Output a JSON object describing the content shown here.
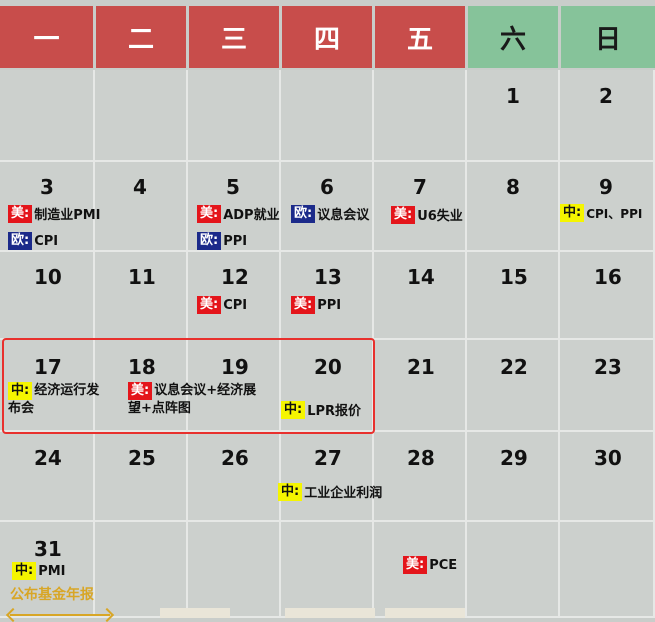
{
  "weekdays": [
    "一",
    "二",
    "三",
    "四",
    "五",
    "六",
    "日"
  ],
  "days": {
    "r0": [
      "",
      "",
      "",
      "",
      "",
      "1",
      "2"
    ],
    "r1": [
      "3",
      "4",
      "5",
      "6",
      "7",
      "8",
      "9"
    ],
    "r2": [
      "10",
      "11",
      "12",
      "13",
      "14",
      "15",
      "16"
    ],
    "r3": [
      "17",
      "18",
      "19",
      "20",
      "21",
      "22",
      "23"
    ],
    "r4": [
      "24",
      "25",
      "26",
      "27",
      "28",
      "29",
      "30"
    ],
    "r5": [
      "31",
      "",
      "",
      "",
      "",
      "",
      ""
    ]
  },
  "events": {
    "d3_us": {
      "tag": "美:",
      "text": "制造业PMI"
    },
    "d3_eu": {
      "tag": "欧:",
      "text": "CPI"
    },
    "d5_us": {
      "tag": "美:",
      "text": "ADP就业"
    },
    "d5_eu": {
      "tag": "欧:",
      "text": "PPI"
    },
    "d6_eu": {
      "tag": "欧:",
      "text": "议息会议"
    },
    "d7_us": {
      "tag": "美:",
      "text": "U6失业"
    },
    "d9_cn": {
      "tag": "中:",
      "text": "CPI、PPI"
    },
    "d12_us": {
      "tag": "美:",
      "text": "CPI"
    },
    "d13_us": {
      "tag": "美:",
      "text": "PPI"
    },
    "d17_cn": {
      "tag": "中:",
      "text": "经济运行发布会"
    },
    "d18_us": {
      "tag": "美:",
      "text": "议息会议+经济展望+点阵图"
    },
    "d20_cn": {
      "tag": "中:",
      "text": "LPR报价"
    },
    "d27_cn": {
      "tag": "中:",
      "text": "工业企业利润"
    },
    "d28_us": {
      "tag": "美:",
      "text": "PCE"
    },
    "d31_cn": {
      "tag": "中:",
      "text": "PMI"
    }
  },
  "footer": {
    "label": "公布基金年报"
  },
  "colors": {
    "weekday_header": "#c84d4b",
    "weekend_header": "#86c39a",
    "us": "#e4151b",
    "eu": "#1b2a8a",
    "cn": "#f5f500",
    "highlight": "#e8302d"
  }
}
